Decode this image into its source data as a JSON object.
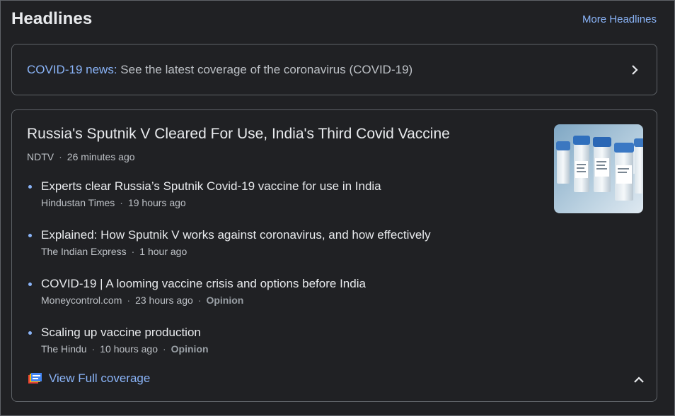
{
  "header": {
    "title": "Headlines",
    "more_link": "More Headlines"
  },
  "covid_banner": {
    "label": "COVID-19 news:",
    "text": " See the latest coverage of the coronavirus (COVID-19)",
    "icon": "chevron-right-icon"
  },
  "story": {
    "headline": "Russia's Sputnik V Cleared For Use, India's Third Covid Vaccine",
    "source": "NDTV",
    "time": "26 minutes ago",
    "thumbnail": "vaccine-vials-image",
    "sub_articles": [
      {
        "title": "Experts clear Russia’s Sputnik Covid-19 vaccine for use in India",
        "source": "Hindustan Times",
        "time": "19 hours ago",
        "tag": ""
      },
      {
        "title": "Explained: How Sputnik V works against coronavirus, and how effectively",
        "source": "The Indian Express",
        "time": "1 hour ago",
        "tag": ""
      },
      {
        "title": "COVID-19 | A looming vaccine crisis and options before India",
        "source": "Moneycontrol.com",
        "time": "23 hours ago",
        "tag": "Opinion"
      },
      {
        "title": "Scaling up vaccine production",
        "source": "The Hindu",
        "time": "10 hours ago",
        "tag": "Opinion"
      }
    ],
    "full_coverage_label": "View Full coverage",
    "dot": "·"
  },
  "colors": {
    "background": "#202124",
    "accent": "#8ab4f8",
    "border": "#5f6368",
    "text": "#e8eaed",
    "secondary_text": "#bdc1c6"
  }
}
